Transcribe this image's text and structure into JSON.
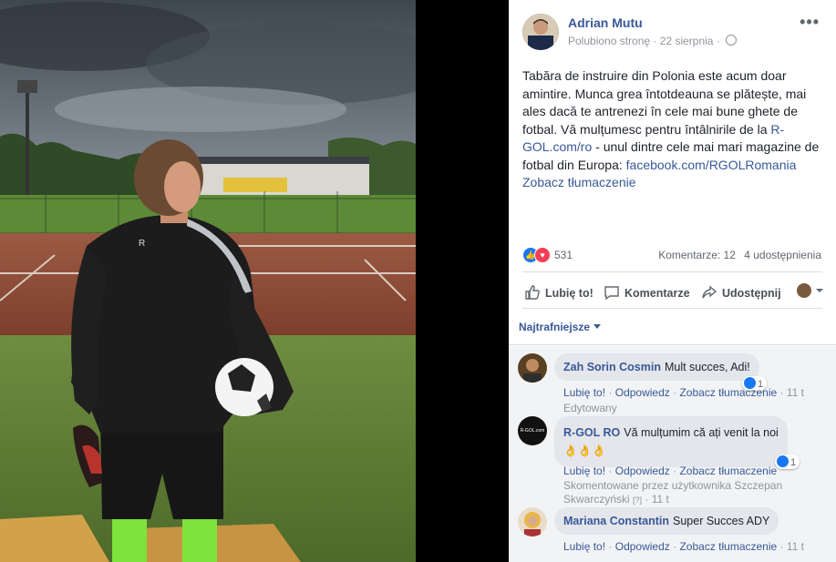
{
  "post": {
    "author": "Adrian Mutu",
    "liked_page": "Polubiono stronę",
    "dot": "·",
    "date": "22 sierpnia",
    "more": "•••",
    "text_main": "Tabăra de instruire din Polonia este acum doar amintire. Munca grea întotdeauna se plătește, mai ales dacă te antrenezi în cele mai bune ghete de fotbal. Vă mulțumesc pentru întâlnirile de la ",
    "link1": "R-GOL.com/ro",
    "text_mid": " - unul dintre cele mai mari magazine de fotbal din Europa: ",
    "link2": "facebook.com/RGOLRomania",
    "see_translation": "Zobacz tłumaczenie"
  },
  "stats": {
    "reactions_count": "531",
    "comments": "Komentarze: 12",
    "shares": "4 udostępnienia"
  },
  "actions": {
    "like": "Lubię to!",
    "comment": "Komentarze",
    "share": "Udostępnij"
  },
  "filter": {
    "label": "Najtrafniejsze"
  },
  "comments": [
    {
      "name": "Zah Sorin Cosmin",
      "text": "Mult succes, Adi!",
      "like": "Lubię to!",
      "reply": "Odpowiedz",
      "translate": "Zobacz tłumaczenie",
      "time": "11 t",
      "reactions": "1",
      "edited": "Edytowany"
    },
    {
      "name": "R-GOL RO",
      "avatar_text": "R-GOL.com",
      "text": "Vă mulțumim că ați venit la noi",
      "emojis": "👌👌👌",
      "like": "Lubię to!",
      "reply": "Odpowiedz",
      "translate": "Zobacz tłumaczenie",
      "reactions": "1",
      "commented_by": "Skomentowane przez użytkownika Szczepan Skwarczyński",
      "help": "[?]",
      "time": "11 t"
    },
    {
      "name": "Mariana Constantin",
      "text": "Super Succes ADY",
      "like": "Lubię to!",
      "reply": "Odpowiedz",
      "translate": "Zobacz tłumaczenie",
      "time": "11 t"
    }
  ],
  "colors": {
    "link": "#385898",
    "like_blue": "#1877f2",
    "love_red": "#f33e58"
  }
}
